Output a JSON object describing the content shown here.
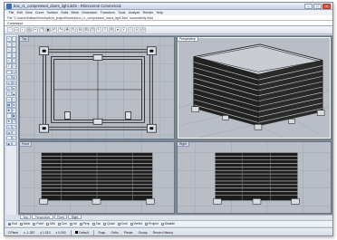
{
  "window": {
    "title": "box_r1_compressed_doors_light.3dm - Rhinoceros Commercial",
    "buttons": [
      "–",
      "□",
      "×"
    ]
  },
  "menubar": {
    "items": [
      "File",
      "Edit",
      "View",
      "Curve",
      "Surface",
      "Solid",
      "Mesh",
      "Dimension",
      "Transform",
      "Tools",
      "Analyze",
      "Render",
      "Help"
    ]
  },
  "command": {
    "history": "File \"C:\\Users\\Kaikan\\Desktop\\box_project\\frames\\box_r1_compressed_doors_light.3dm\" successfully read",
    "prompt": "Command:"
  },
  "toolbar": {
    "icons": [
      "new-icon",
      "open-icon",
      "save-icon",
      "print-icon",
      "cut-icon",
      "copy-icon",
      "paste-icon",
      "undo-icon",
      "redo-icon",
      "pan-icon",
      "rotate-icon",
      "zoom-icon",
      "zoom-window-icon",
      "zoom-extents-icon",
      "select-icon",
      "layer-icon",
      "properties-icon",
      "render-icon",
      "shaded-icon",
      "wireframe-icon",
      "grid-icon",
      "osnap-icon"
    ]
  },
  "viewports": {
    "top": "Top",
    "perspective": "Perspective",
    "front": "Front",
    "right": "Right"
  },
  "viewtabs": [
    "Top",
    "Perspective",
    "Front",
    "Right"
  ],
  "osnaps": [
    {
      "label": "End",
      "on": true
    },
    {
      "label": "Near",
      "on": false
    },
    {
      "label": "Point",
      "on": false
    },
    {
      "label": "Mid",
      "on": false
    },
    {
      "label": "Cen",
      "on": false
    },
    {
      "label": "Int",
      "on": false
    },
    {
      "label": "Perp",
      "on": false
    },
    {
      "label": "Tan",
      "on": false
    },
    {
      "label": "Quad",
      "on": false
    },
    {
      "label": "Knot",
      "on": false
    },
    {
      "label": "Vertex",
      "on": false
    },
    {
      "label": "Project",
      "on": false
    },
    {
      "label": "Disable",
      "on": false
    }
  ],
  "status": {
    "plane": "CPlane",
    "x": "x -1.387",
    "y": "y 1.013",
    "z": "z 0.000",
    "layer": "Default",
    "modes": [
      "Snap",
      "Ortho",
      "Planar",
      "Osnap",
      "Record History"
    ]
  },
  "colors": {
    "viewport_bg": "#b9bec6",
    "wire_dark": "#111111",
    "active_label": "#ffffff"
  }
}
